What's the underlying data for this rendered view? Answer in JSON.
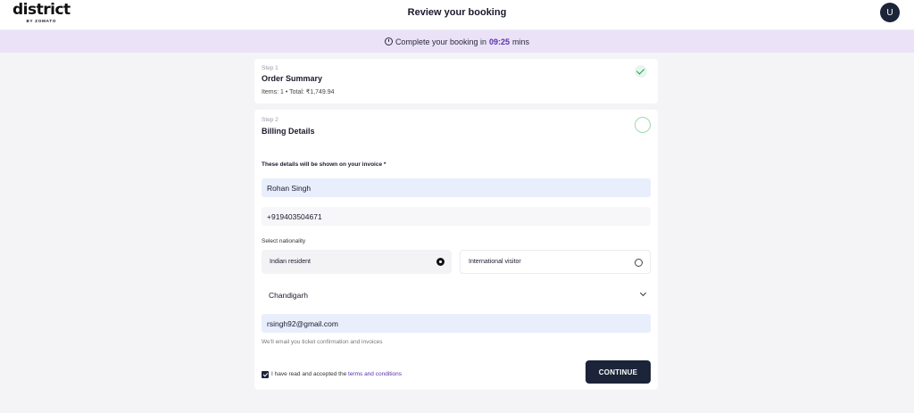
{
  "header": {
    "logo_main": "district",
    "logo_sub": "BY ZOMATO",
    "title": "Review your booking",
    "avatar_initial": "U"
  },
  "timer": {
    "prefix": "Complete your booking in",
    "time": "09:25",
    "suffix": "mins"
  },
  "step1": {
    "label": "Step 1",
    "title": "Order Summary",
    "summary": "Items: 1 • Total: ₹1,749.94",
    "status": "completed"
  },
  "step2": {
    "label": "Step 2",
    "title": "Billing Details",
    "invoice_note": "These details will be shown on your invoice *",
    "name_value": "Rohan Singh",
    "phone_value": "+919403504671",
    "nationality_label": "Select nationality",
    "nationality_options": [
      {
        "label": "Indian resident",
        "selected": true
      },
      {
        "label": "International visitor",
        "selected": false
      }
    ],
    "state_value": "Chandigarh",
    "email_value": "rsingh92@gmail.com",
    "email_note": "We'll email you ticket confirmation and invoices",
    "terms_prefix": "I have read and accepted the",
    "terms_link": "terms and conditions",
    "terms_checked": true,
    "continue_label": "CONTINUE"
  },
  "colors": {
    "accent_purple": "#5b2fb0",
    "timer_bg": "#ebe2f7",
    "dark_navy": "#1b2438",
    "success_green": "#1f9e55",
    "input_filled_bg": "#e9eefc"
  }
}
